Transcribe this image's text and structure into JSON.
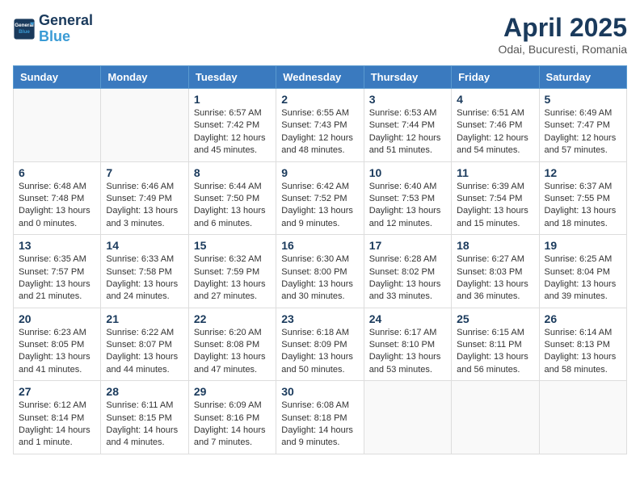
{
  "logo": {
    "text_general": "General",
    "text_blue": "Blue"
  },
  "title": "April 2025",
  "location": "Odai, Bucuresti, Romania",
  "days_of_week": [
    "Sunday",
    "Monday",
    "Tuesday",
    "Wednesday",
    "Thursday",
    "Friday",
    "Saturday"
  ],
  "weeks": [
    [
      {
        "day": "",
        "info": ""
      },
      {
        "day": "",
        "info": ""
      },
      {
        "day": "1",
        "info": "Sunrise: 6:57 AM\nSunset: 7:42 PM\nDaylight: 12 hours and 45 minutes."
      },
      {
        "day": "2",
        "info": "Sunrise: 6:55 AM\nSunset: 7:43 PM\nDaylight: 12 hours and 48 minutes."
      },
      {
        "day": "3",
        "info": "Sunrise: 6:53 AM\nSunset: 7:44 PM\nDaylight: 12 hours and 51 minutes."
      },
      {
        "day": "4",
        "info": "Sunrise: 6:51 AM\nSunset: 7:46 PM\nDaylight: 12 hours and 54 minutes."
      },
      {
        "day": "5",
        "info": "Sunrise: 6:49 AM\nSunset: 7:47 PM\nDaylight: 12 hours and 57 minutes."
      }
    ],
    [
      {
        "day": "6",
        "info": "Sunrise: 6:48 AM\nSunset: 7:48 PM\nDaylight: 13 hours and 0 minutes."
      },
      {
        "day": "7",
        "info": "Sunrise: 6:46 AM\nSunset: 7:49 PM\nDaylight: 13 hours and 3 minutes."
      },
      {
        "day": "8",
        "info": "Sunrise: 6:44 AM\nSunset: 7:50 PM\nDaylight: 13 hours and 6 minutes."
      },
      {
        "day": "9",
        "info": "Sunrise: 6:42 AM\nSunset: 7:52 PM\nDaylight: 13 hours and 9 minutes."
      },
      {
        "day": "10",
        "info": "Sunrise: 6:40 AM\nSunset: 7:53 PM\nDaylight: 13 hours and 12 minutes."
      },
      {
        "day": "11",
        "info": "Sunrise: 6:39 AM\nSunset: 7:54 PM\nDaylight: 13 hours and 15 minutes."
      },
      {
        "day": "12",
        "info": "Sunrise: 6:37 AM\nSunset: 7:55 PM\nDaylight: 13 hours and 18 minutes."
      }
    ],
    [
      {
        "day": "13",
        "info": "Sunrise: 6:35 AM\nSunset: 7:57 PM\nDaylight: 13 hours and 21 minutes."
      },
      {
        "day": "14",
        "info": "Sunrise: 6:33 AM\nSunset: 7:58 PM\nDaylight: 13 hours and 24 minutes."
      },
      {
        "day": "15",
        "info": "Sunrise: 6:32 AM\nSunset: 7:59 PM\nDaylight: 13 hours and 27 minutes."
      },
      {
        "day": "16",
        "info": "Sunrise: 6:30 AM\nSunset: 8:00 PM\nDaylight: 13 hours and 30 minutes."
      },
      {
        "day": "17",
        "info": "Sunrise: 6:28 AM\nSunset: 8:02 PM\nDaylight: 13 hours and 33 minutes."
      },
      {
        "day": "18",
        "info": "Sunrise: 6:27 AM\nSunset: 8:03 PM\nDaylight: 13 hours and 36 minutes."
      },
      {
        "day": "19",
        "info": "Sunrise: 6:25 AM\nSunset: 8:04 PM\nDaylight: 13 hours and 39 minutes."
      }
    ],
    [
      {
        "day": "20",
        "info": "Sunrise: 6:23 AM\nSunset: 8:05 PM\nDaylight: 13 hours and 41 minutes."
      },
      {
        "day": "21",
        "info": "Sunrise: 6:22 AM\nSunset: 8:07 PM\nDaylight: 13 hours and 44 minutes."
      },
      {
        "day": "22",
        "info": "Sunrise: 6:20 AM\nSunset: 8:08 PM\nDaylight: 13 hours and 47 minutes."
      },
      {
        "day": "23",
        "info": "Sunrise: 6:18 AM\nSunset: 8:09 PM\nDaylight: 13 hours and 50 minutes."
      },
      {
        "day": "24",
        "info": "Sunrise: 6:17 AM\nSunset: 8:10 PM\nDaylight: 13 hours and 53 minutes."
      },
      {
        "day": "25",
        "info": "Sunrise: 6:15 AM\nSunset: 8:11 PM\nDaylight: 13 hours and 56 minutes."
      },
      {
        "day": "26",
        "info": "Sunrise: 6:14 AM\nSunset: 8:13 PM\nDaylight: 13 hours and 58 minutes."
      }
    ],
    [
      {
        "day": "27",
        "info": "Sunrise: 6:12 AM\nSunset: 8:14 PM\nDaylight: 14 hours and 1 minute."
      },
      {
        "day": "28",
        "info": "Sunrise: 6:11 AM\nSunset: 8:15 PM\nDaylight: 14 hours and 4 minutes."
      },
      {
        "day": "29",
        "info": "Sunrise: 6:09 AM\nSunset: 8:16 PM\nDaylight: 14 hours and 7 minutes."
      },
      {
        "day": "30",
        "info": "Sunrise: 6:08 AM\nSunset: 8:18 PM\nDaylight: 14 hours and 9 minutes."
      },
      {
        "day": "",
        "info": ""
      },
      {
        "day": "",
        "info": ""
      },
      {
        "day": "",
        "info": ""
      }
    ]
  ]
}
